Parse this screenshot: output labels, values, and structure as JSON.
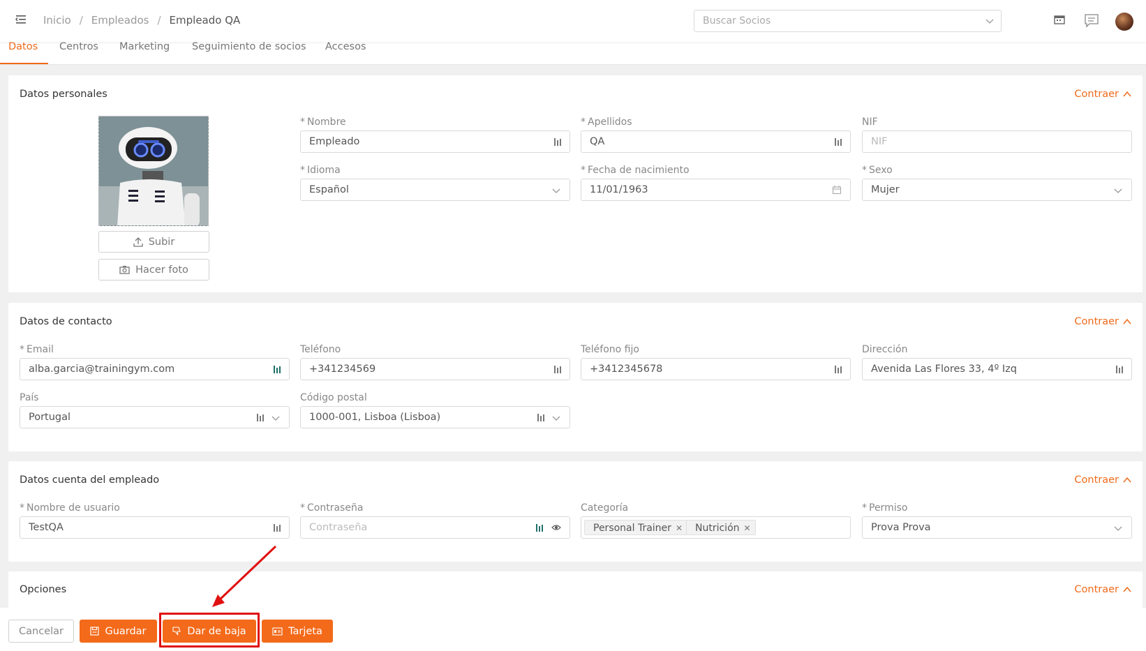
{
  "header": {
    "breadcrumb": [
      "Inicio",
      "Empleados",
      "Empleado QA"
    ],
    "search_placeholder": "Buscar Socios"
  },
  "tabs": [
    "Datos",
    "Centros",
    "Marketing",
    "Seguimiento de socios",
    "Accesos"
  ],
  "personal": {
    "title": "Datos personales",
    "collapse": "Contraer",
    "upload": "Subir",
    "photo": "Hacer foto",
    "nombre_label": "Nombre",
    "nombre_value": "Empleado",
    "apellidos_label": "Apellidos",
    "apellidos_value": "QA",
    "nif_label": "NIF",
    "nif_placeholder": "NIF",
    "idioma_label": "Idioma",
    "idioma_value": "Español",
    "fecha_label": "Fecha de nacimiento",
    "fecha_value": "11/01/1963",
    "sexo_label": "Sexo",
    "sexo_value": "Mujer"
  },
  "contact": {
    "title": "Datos de contacto",
    "collapse": "Contraer",
    "email_label": "Email",
    "email_value": "alba.garcia@trainingym.com",
    "telefono_label": "Teléfono",
    "telefono_value": "+341234569",
    "fijo_label": "Teléfono fijo",
    "fijo_value": "+3412345678",
    "direccion_label": "Dirección",
    "direccion_value": "Avenida Las Flores 33, 4º Izq",
    "pais_label": "País",
    "pais_value": "Portugal",
    "postal_label": "Código postal",
    "postal_value": "1000-001, Lisboa (Lisboa)"
  },
  "account": {
    "title": "Datos cuenta del empleado",
    "collapse": "Contraer",
    "usuario_label": "Nombre de usuario",
    "usuario_value": "TestQA",
    "pass_label": "Contraseña",
    "pass_placeholder": "Contraseña",
    "categoria_label": "Categoría",
    "categorias": [
      "Personal Trainer",
      "Nutrición"
    ],
    "permiso_label": "Permiso",
    "permiso_value": "Prova Prova"
  },
  "options": {
    "title": "Opciones",
    "collapse": "Contraer"
  },
  "footer": {
    "cancel": "Cancelar",
    "save": "Guardar",
    "unsubscribe": "Dar de baja",
    "card": "Tarjeta"
  },
  "colors": {
    "accent": "#f36a1a",
    "annotation": "#e01010"
  },
  "icons": [
    "menu-icon",
    "chevron-down-icon",
    "calendar-icon",
    "chat-icon",
    "avatar",
    "chevron-up-icon",
    "keyboard-icon",
    "eye-icon",
    "upload-icon",
    "camera-icon",
    "save-icon",
    "thumbs-down-icon",
    "id-card-icon"
  ]
}
